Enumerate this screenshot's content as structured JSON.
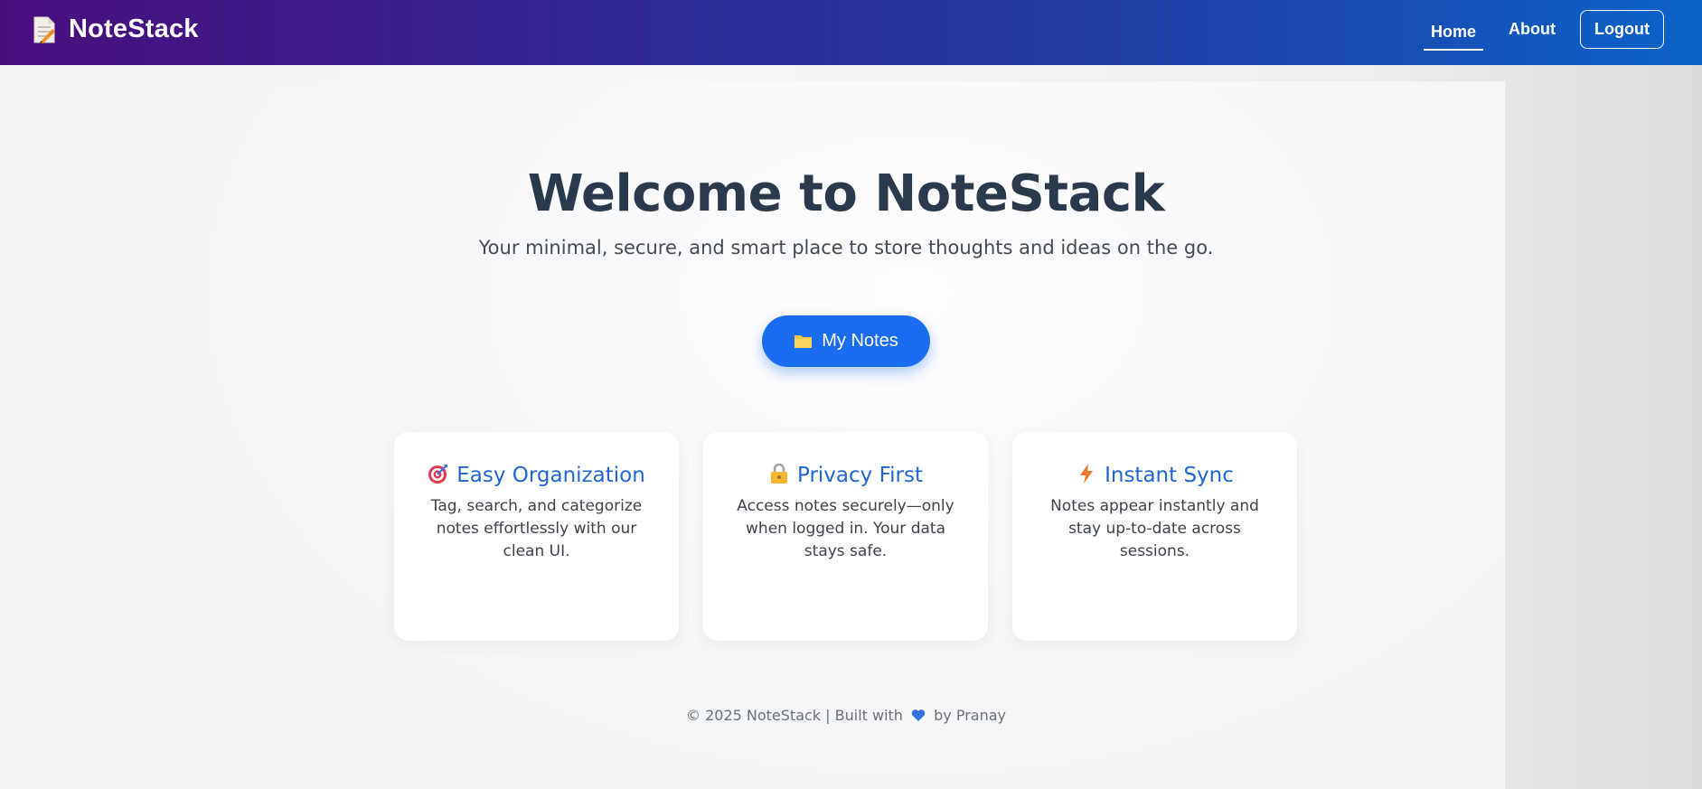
{
  "navbar": {
    "brand": "NoteStack",
    "brand_icon": "memo-icon",
    "links": [
      {
        "label": "Home",
        "active": true
      },
      {
        "label": "About",
        "active": false
      }
    ],
    "logout_label": "Logout"
  },
  "hero": {
    "title": "Welcome to NoteStack",
    "subtitle": "Your minimal, secure, and smart place to store thoughts and ideas on the go.",
    "cta_label": "My Notes",
    "cta_icon": "folder-icon"
  },
  "features": [
    {
      "icon": "target-icon",
      "title": "Easy Organization",
      "text": "Tag, search, and categorize notes effortlessly with our clean UI."
    },
    {
      "icon": "lock-icon",
      "title": "Privacy First",
      "text": "Access notes securely—only when logged in. Your data stays safe."
    },
    {
      "icon": "lightning-icon",
      "title": "Instant Sync",
      "text": "Notes appear instantly and stay up-to-date across sessions."
    }
  ],
  "footer": {
    "prefix": "© 2025 NoteStack | Built with",
    "icon": "heart-icon",
    "suffix": "by Pranay"
  },
  "colors": {
    "accent": "#1a6cf0",
    "title_text": "#2a3a4c",
    "card_title": "#1f66d6",
    "navbar_start": "#4a0d7e",
    "navbar_end": "#0b63c9"
  }
}
